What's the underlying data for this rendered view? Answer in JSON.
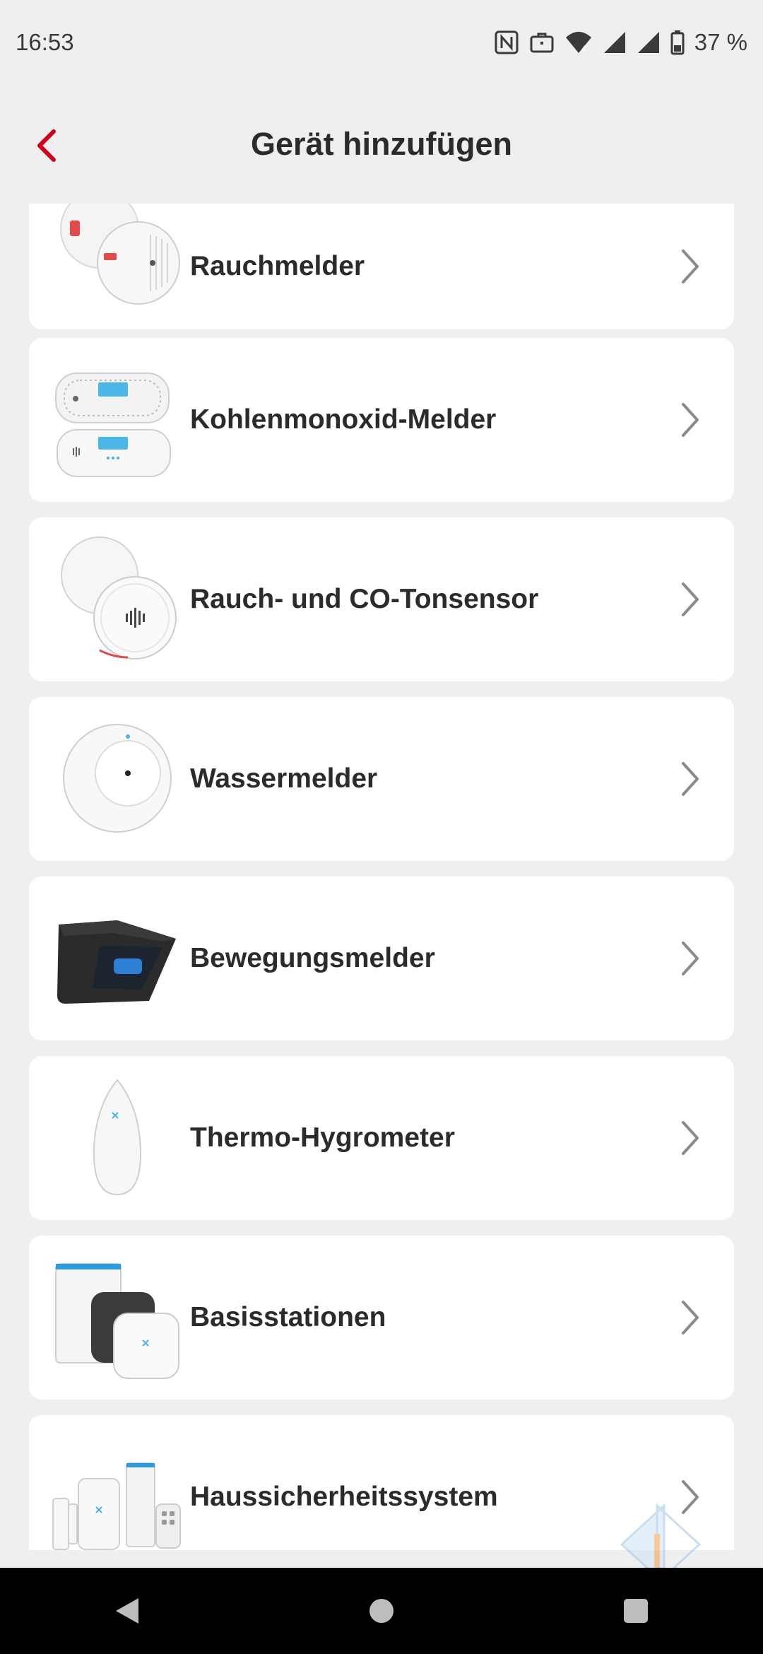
{
  "status_bar": {
    "time": "16:53",
    "battery_text": "37 %",
    "icons": [
      "nfc-icon",
      "briefcase-icon",
      "wifi-icon",
      "signal-icon",
      "signal-icon",
      "battery-icon"
    ]
  },
  "header": {
    "title": "Gerät hinzufügen",
    "back_icon": "chevron-left-icon",
    "accent_color": "#d0021b"
  },
  "devices": [
    {
      "label": "Rauchmelder",
      "icon": "smoke-detector-image"
    },
    {
      "label": "Kohlenmonoxid-Melder",
      "icon": "co-detector-image"
    },
    {
      "label": "Rauch- und CO-Tonsensor",
      "icon": "sound-sensor-image"
    },
    {
      "label": "Wassermelder",
      "icon": "water-detector-image"
    },
    {
      "label": "Bewegungsmelder",
      "icon": "motion-detector-image"
    },
    {
      "label": "Thermo-Hygrometer",
      "icon": "thermo-hygrometer-image"
    },
    {
      "label": "Basisstationen",
      "icon": "base-station-image"
    },
    {
      "label": "Haussicherheitssystem",
      "icon": "home-security-system-image"
    }
  ],
  "nav_bar": {
    "buttons": [
      "back-triangle-icon",
      "home-circle-icon",
      "recents-square-icon"
    ]
  }
}
